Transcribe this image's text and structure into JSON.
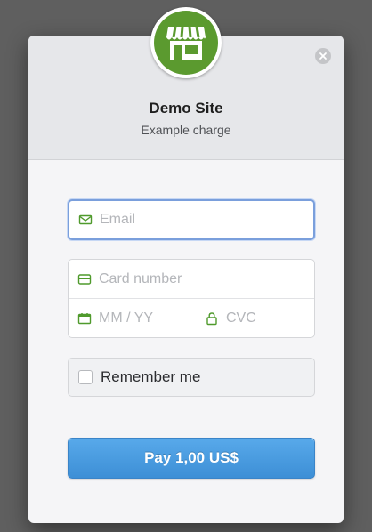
{
  "header": {
    "title": "Demo Site",
    "subtitle": "Example charge",
    "logo_icon": "storefront-icon",
    "close_icon": "close-icon"
  },
  "form": {
    "email": {
      "placeholder": "Email",
      "icon": "envelope-icon"
    },
    "card_number": {
      "placeholder": "Card number",
      "icon": "credit-card-icon"
    },
    "expiry": {
      "placeholder": "MM / YY",
      "icon": "calendar-icon"
    },
    "cvc": {
      "placeholder": "CVC",
      "icon": "lock-icon"
    },
    "remember_me": {
      "label": "Remember me",
      "checked": false
    },
    "pay_button": {
      "label": "Pay 1,00 US$"
    }
  },
  "colors": {
    "accent_blue": "#4a9be0",
    "logo_green": "#5b9a2f",
    "icon_green": "#4f9a2c",
    "focus_border": "#7a9fdc"
  }
}
